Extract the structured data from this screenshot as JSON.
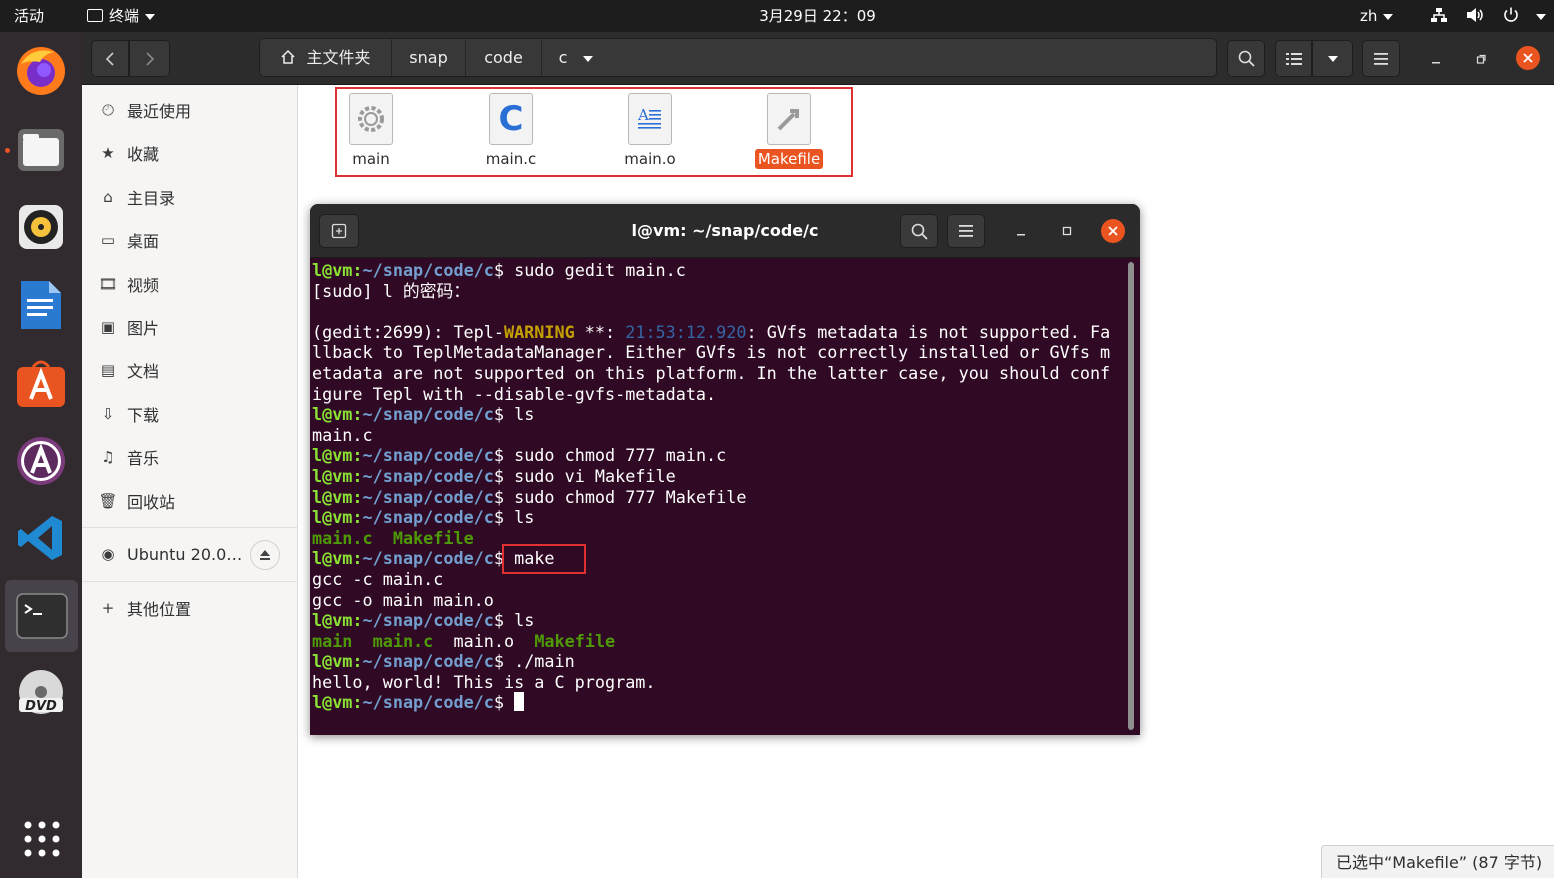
{
  "topbar": {
    "activities": "活动",
    "app_menu": "终端",
    "clock": "3月29日  22：09",
    "input_method": "zh"
  },
  "dock": {
    "apps": [
      "firefox",
      "files",
      "rhythmbox",
      "libreoffice-writer",
      "ubuntu-software",
      "software-updater",
      "vscode",
      "terminal",
      "dvd"
    ]
  },
  "files": {
    "pathbar": [
      "主文件夹",
      "snap",
      "code",
      "c"
    ],
    "sidebar": {
      "items": [
        {
          "label": "最近使用",
          "icon": "clock-icon"
        },
        {
          "label": "收藏",
          "icon": "star-icon"
        },
        {
          "label": "主目录",
          "icon": "home-icon"
        },
        {
          "label": "桌面",
          "icon": "desktop-icon"
        },
        {
          "label": "视频",
          "icon": "video-icon"
        },
        {
          "label": "图片",
          "icon": "picture-icon"
        },
        {
          "label": "文档",
          "icon": "document-icon"
        },
        {
          "label": "下载",
          "icon": "download-icon"
        },
        {
          "label": "音乐",
          "icon": "music-icon"
        },
        {
          "label": "回收站",
          "icon": "trash-icon"
        }
      ],
      "device": "Ubuntu 20.0…",
      "other_locations": "其他位置"
    },
    "items": [
      {
        "name": "main",
        "icon": "executable-icon",
        "selected": false
      },
      {
        "name": "main.c",
        "icon": "c-source-icon",
        "selected": false
      },
      {
        "name": "main.o",
        "icon": "text-file-icon",
        "selected": false
      },
      {
        "name": "Makefile",
        "icon": "makefile-icon",
        "selected": true
      }
    ],
    "status": "已选中“Makefile” (87 字节)"
  },
  "terminal": {
    "title": "l@vm: ~/snap/code/c",
    "prompt_user": "l@vm:",
    "prompt_path": "~/snap/code/c",
    "prompt_end": "$ ",
    "lines": {
      "cmd1": "sudo gedit main.c",
      "sudo_prompt": "[sudo] l 的密码：",
      "warn_a": "(gedit:2699): Tepl-",
      "warn_word": "WARNING",
      "warn_b": " **: ",
      "warn_time": "21:53:12.920",
      "warn_c": ": GVfs metadata is not supported. Fa",
      "warn2": "llback to TeplMetadataManager. Either GVfs is not correctly installed or GVfs m",
      "warn3": "etadata are not supported on this platform. In the latter case, you should conf",
      "warn4": "igure Tepl with --disable-gvfs-metadata.",
      "cmd2": "ls",
      "out2": "main.c",
      "cmd3": "sudo chmod 777 main.c",
      "cmd4": "sudo vi Makefile",
      "cmd5": "sudo chmod 777 Makefile",
      "cmd6": "ls",
      "out6_a": "main.c",
      "out6_b": "Makefile",
      "cmd7": "make",
      "out7a": "gcc -c main.c",
      "out7b": "gcc -o main main.o",
      "cmd8": "ls",
      "out8_main": "main",
      "out8_mainc": "main.c",
      "out8_maino": "main.o",
      "out8_makefile": "Makefile",
      "cmd9": "./main",
      "out9": "hello, world! This is a C program."
    }
  },
  "colors": {
    "accent": "#e95420",
    "terminal_bg": "#300a24",
    "prompt_user": "#8ae234",
    "prompt_path": "#729fcf",
    "annotation_red": "#e03030"
  }
}
